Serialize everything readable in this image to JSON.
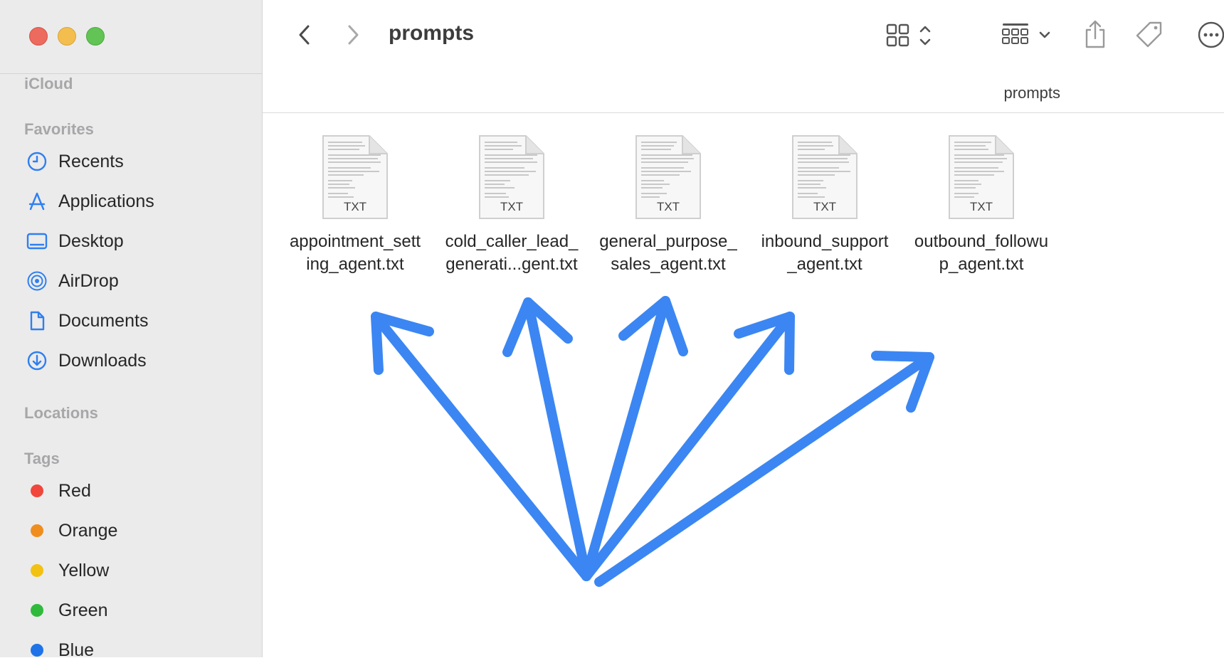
{
  "window": {
    "title": "prompts",
    "path_label": "prompts"
  },
  "sidebar": {
    "icloud_header": "iCloud",
    "favorites_header": "Favorites",
    "favorites": [
      {
        "label": "Recents",
        "icon": "clock-icon"
      },
      {
        "label": "Applications",
        "icon": "applications-icon"
      },
      {
        "label": "Desktop",
        "icon": "desktop-icon"
      },
      {
        "label": "AirDrop",
        "icon": "airdrop-icon"
      },
      {
        "label": "Documents",
        "icon": "document-icon"
      },
      {
        "label": "Downloads",
        "icon": "download-icon"
      }
    ],
    "locations_header": "Locations",
    "tags_header": "Tags",
    "tags": [
      {
        "label": "Red",
        "color": "#f0463c"
      },
      {
        "label": "Orange",
        "color": "#ef8e1e"
      },
      {
        "label": "Yellow",
        "color": "#f3c112"
      },
      {
        "label": "Green",
        "color": "#2fba3c"
      },
      {
        "label": "Blue",
        "color": "#1f73e8"
      }
    ]
  },
  "files": [
    {
      "name_line1": "appointment_sett",
      "name_line2": "ing_agent.txt",
      "badge": "TXT"
    },
    {
      "name_line1": "cold_caller_lead_",
      "name_line2": "generati...gent.txt",
      "badge": "TXT"
    },
    {
      "name_line1": "general_purpose_",
      "name_line2": "sales_agent.txt",
      "badge": "TXT"
    },
    {
      "name_line1": "inbound_support",
      "name_line2": "_agent.txt",
      "badge": "TXT"
    },
    {
      "name_line1": "outbound_followu",
      "name_line2": "p_agent.txt",
      "badge": "TXT"
    }
  ],
  "colors": {
    "accent": "#2f7ff0",
    "annotation_arrow": "#3b86f2"
  }
}
